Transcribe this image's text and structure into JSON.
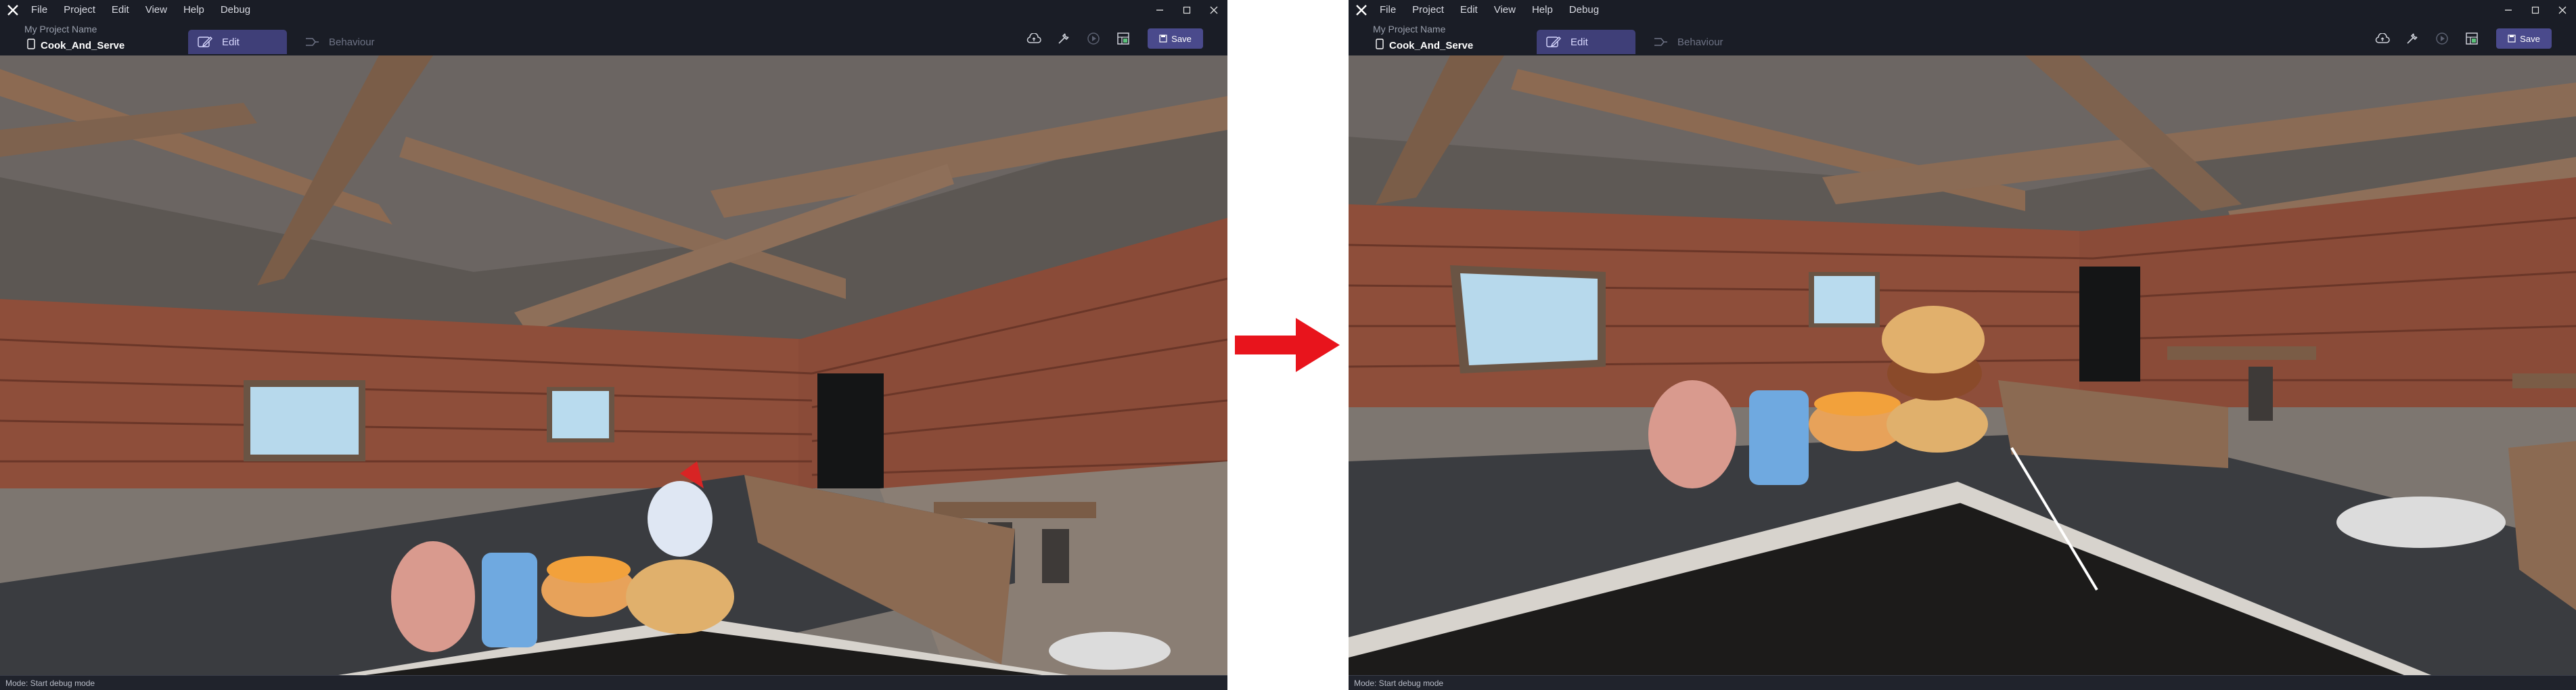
{
  "left": {
    "menu": [
      "File",
      "Project",
      "Edit",
      "View",
      "Help",
      "Debug"
    ],
    "project_name": "My Project Name",
    "scene_name": "Cook_And_Serve",
    "tabs": {
      "edit": "Edit",
      "behaviour": "Behaviour"
    },
    "save_label": "Save",
    "status": "Mode: Start debug mode"
  },
  "right": {
    "menu": [
      "File",
      "Project",
      "Edit",
      "View",
      "Help",
      "Debug"
    ],
    "project_name": "My Project Name",
    "scene_name": "Cook_And_Serve",
    "tabs": {
      "edit": "Edit",
      "behaviour": "Behaviour"
    },
    "save_label": "Save",
    "status": "Mode: Start debug mode"
  },
  "colors": {
    "accent": "#4a4a8c",
    "active_tab": "#3f3f78",
    "arrow": "#e8141c"
  },
  "icons": [
    "app-logo-icon",
    "document-icon",
    "edit-pencil-icon",
    "behaviour-flow-icon",
    "cloud-icon",
    "wrench-icon",
    "play-icon",
    "grid-icon",
    "save-icon",
    "minimize-icon",
    "maximize-icon",
    "close-icon"
  ]
}
